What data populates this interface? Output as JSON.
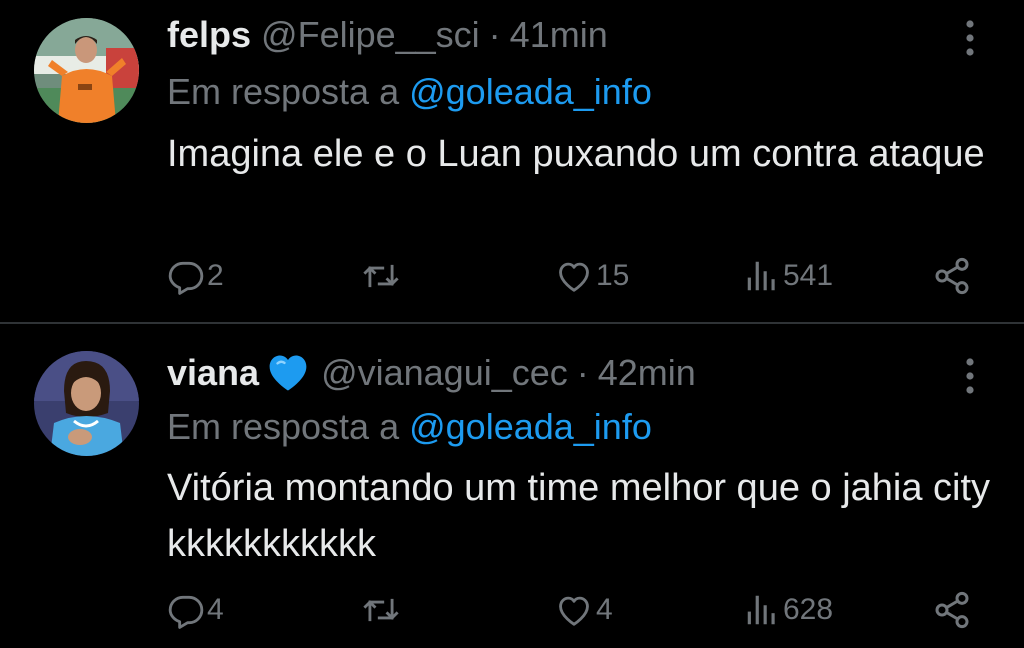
{
  "colors": {
    "background": "#000000",
    "primary_text": "#e7e9ea",
    "secondary_text": "#71767b",
    "link": "#1d9bf0",
    "divider": "#2f3336",
    "heart_badge": "#1d9bf0"
  },
  "tweets": [
    {
      "display_name": "felps",
      "handle": "@Felipe__sci",
      "separator": "·",
      "time": "41min",
      "reply_prefix": "Em resposta a",
      "reply_to": "@goleada_info",
      "text": "Imagina ele e o Luan puxando um contra ataque",
      "replies": "2",
      "retweets": "",
      "likes": "15",
      "views": "541",
      "avatar_icon": "avatar-orange-kit-player",
      "has_heart_badge": false
    },
    {
      "display_name": "viana",
      "handle": "@vianagui_cec",
      "separator": "·",
      "time": "42min",
      "reply_prefix": "Em resposta a",
      "reply_to": "@goleada_info",
      "text": "Vitória montando um time melhor que o jahia city kkkkkkkkkkk",
      "replies": "4",
      "retweets": "",
      "likes": "4",
      "views": "628",
      "avatar_icon": "avatar-blue-kit-player",
      "has_heart_badge": true
    }
  ]
}
